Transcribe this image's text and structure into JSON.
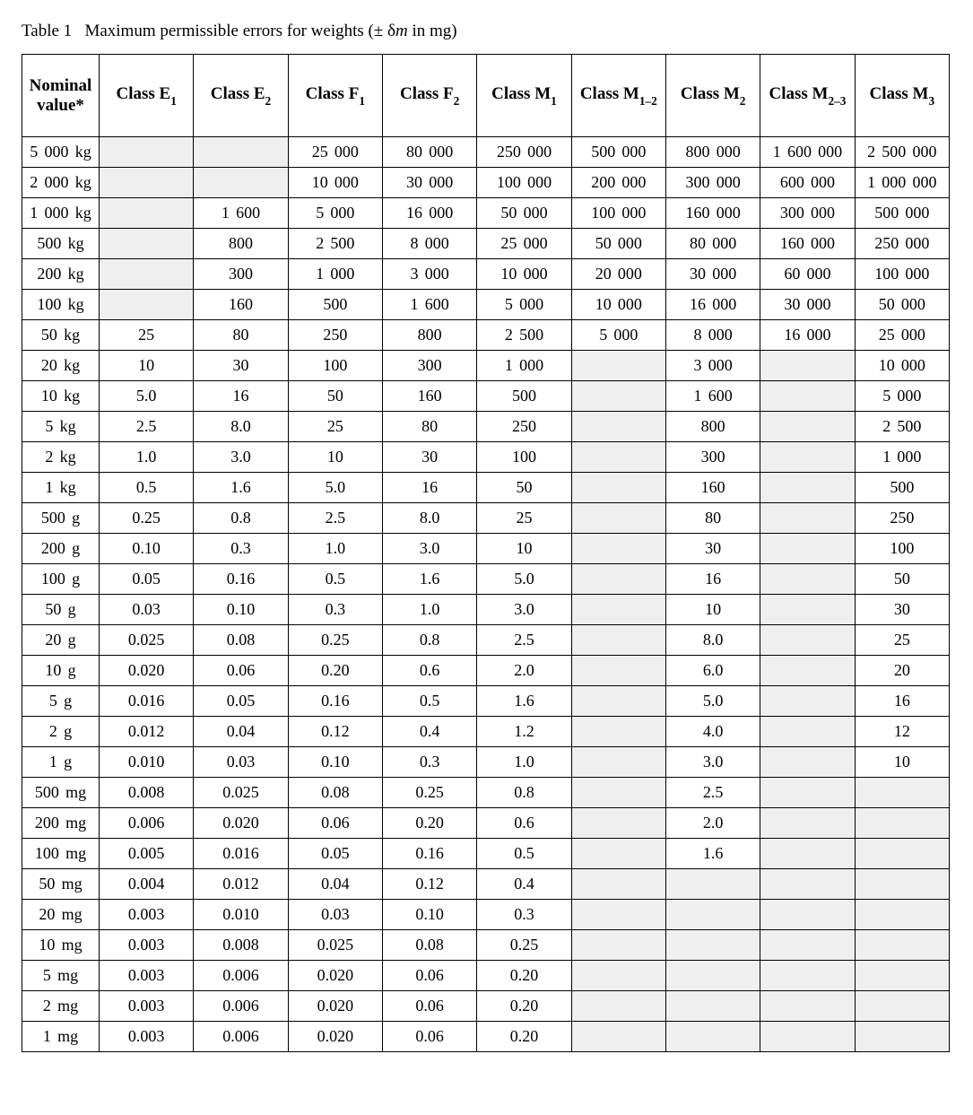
{
  "title_prefix": "Table 1",
  "title_text": "Maximum permissible errors for weights (± δ",
  "title_italic": "m",
  "title_suffix": " in mg)",
  "headers": [
    {
      "label": "Nominal value*",
      "sub": ""
    },
    {
      "label": "Class E",
      "sub": "1"
    },
    {
      "label": "Class E",
      "sub": "2"
    },
    {
      "label": "Class F",
      "sub": "1"
    },
    {
      "label": "Class F",
      "sub": "2"
    },
    {
      "label": "Class M",
      "sub": "1"
    },
    {
      "label": "Class M",
      "sub": "1–2"
    },
    {
      "label": "Class M",
      "sub": "2"
    },
    {
      "label": "Class M",
      "sub": "2–3"
    },
    {
      "label": "Class M",
      "sub": "3"
    }
  ],
  "chart_data": {
    "type": "table",
    "title": "Maximum permissible errors for weights (± δm in mg)",
    "columns": [
      "Nominal value",
      "Class E1",
      "Class E2",
      "Class F1",
      "Class F2",
      "Class M1",
      "Class M1-2",
      "Class M2",
      "Class M2-3",
      "Class M3"
    ],
    "rows": [
      {
        "nominal": "5 000 kg",
        "values": [
          "",
          "",
          "25 000",
          "80 000",
          "250 000",
          "500 000",
          "800 000",
          "1 600 000",
          "2 500 000"
        ],
        "shaded": [
          0,
          1
        ]
      },
      {
        "nominal": "2 000 kg",
        "values": [
          "",
          "",
          "10 000",
          "30 000",
          "100 000",
          "200 000",
          "300 000",
          "600 000",
          "1 000 000"
        ],
        "shaded": [
          0,
          1
        ]
      },
      {
        "nominal": "1 000 kg",
        "values": [
          "",
          "1 600",
          "5 000",
          "16 000",
          "50 000",
          "100 000",
          "160 000",
          "300 000",
          "500 000"
        ],
        "shaded": [
          0
        ]
      },
      {
        "nominal": "500 kg",
        "values": [
          "",
          "800",
          "2 500",
          "8 000",
          "25 000",
          "50 000",
          "80 000",
          "160 000",
          "250 000"
        ],
        "shaded": [
          0
        ]
      },
      {
        "nominal": "200 kg",
        "values": [
          "",
          "300",
          "1 000",
          "3 000",
          "10 000",
          "20 000",
          "30 000",
          "60 000",
          "100 000"
        ],
        "shaded": [
          0
        ]
      },
      {
        "nominal": "100 kg",
        "values": [
          "",
          "160",
          "500",
          "1 600",
          "5 000",
          "10 000",
          "16 000",
          "30 000",
          "50 000"
        ],
        "shaded": [
          0
        ]
      },
      {
        "nominal": "50 kg",
        "values": [
          "25",
          "80",
          "250",
          "800",
          "2 500",
          "5 000",
          "8 000",
          "16 000",
          "25 000"
        ],
        "shaded": []
      },
      {
        "nominal": "20 kg",
        "values": [
          "10",
          "30",
          "100",
          "300",
          "1 000",
          "",
          "3 000",
          "",
          "10 000"
        ],
        "shaded": [
          5,
          7
        ]
      },
      {
        "nominal": "10 kg",
        "values": [
          "5.0",
          "16",
          "50",
          "160",
          "500",
          "",
          "1 600",
          "",
          "5 000"
        ],
        "shaded": [
          5,
          7
        ]
      },
      {
        "nominal": "5 kg",
        "values": [
          "2.5",
          "8.0",
          "25",
          "80",
          "250",
          "",
          "800",
          "",
          "2 500"
        ],
        "shaded": [
          5,
          7
        ]
      },
      {
        "nominal": "2 kg",
        "values": [
          "1.0",
          "3.0",
          "10",
          "30",
          "100",
          "",
          "300",
          "",
          "1 000"
        ],
        "shaded": [
          5,
          7
        ]
      },
      {
        "nominal": "1 kg",
        "values": [
          "0.5",
          "1.6",
          "5.0",
          "16",
          "50",
          "",
          "160",
          "",
          "500"
        ],
        "shaded": [
          5,
          7
        ]
      },
      {
        "nominal": "500 g",
        "values": [
          "0.25",
          "0.8",
          "2.5",
          "8.0",
          "25",
          "",
          "80",
          "",
          "250"
        ],
        "shaded": [
          5,
          7
        ]
      },
      {
        "nominal": "200 g",
        "values": [
          "0.10",
          "0.3",
          "1.0",
          "3.0",
          "10",
          "",
          "30",
          "",
          "100"
        ],
        "shaded": [
          5,
          7
        ]
      },
      {
        "nominal": "100 g",
        "values": [
          "0.05",
          "0.16",
          "0.5",
          "1.6",
          "5.0",
          "",
          "16",
          "",
          "50"
        ],
        "shaded": [
          5,
          7
        ]
      },
      {
        "nominal": "50 g",
        "values": [
          "0.03",
          "0.10",
          "0.3",
          "1.0",
          "3.0",
          "",
          "10",
          "",
          "30"
        ],
        "shaded": [
          5,
          7
        ]
      },
      {
        "nominal": "20 g",
        "values": [
          "0.025",
          "0.08",
          "0.25",
          "0.8",
          "2.5",
          "",
          "8.0",
          "",
          "25"
        ],
        "shaded": [
          5,
          7
        ]
      },
      {
        "nominal": "10 g",
        "values": [
          "0.020",
          "0.06",
          "0.20",
          "0.6",
          "2.0",
          "",
          "6.0",
          "",
          "20"
        ],
        "shaded": [
          5,
          7
        ]
      },
      {
        "nominal": "5 g",
        "values": [
          "0.016",
          "0.05",
          "0.16",
          "0.5",
          "1.6",
          "",
          "5.0",
          "",
          "16"
        ],
        "shaded": [
          5,
          7
        ]
      },
      {
        "nominal": "2 g",
        "values": [
          "0.012",
          "0.04",
          "0.12",
          "0.4",
          "1.2",
          "",
          "4.0",
          "",
          "12"
        ],
        "shaded": [
          5,
          7
        ]
      },
      {
        "nominal": "1 g",
        "values": [
          "0.010",
          "0.03",
          "0.10",
          "0.3",
          "1.0",
          "",
          "3.0",
          "",
          "10"
        ],
        "shaded": [
          5,
          7
        ]
      },
      {
        "nominal": "500 mg",
        "values": [
          "0.008",
          "0.025",
          "0.08",
          "0.25",
          "0.8",
          "",
          "2.5",
          "",
          ""
        ],
        "shaded": [
          5,
          7,
          8
        ]
      },
      {
        "nominal": "200 mg",
        "values": [
          "0.006",
          "0.020",
          "0.06",
          "0.20",
          "0.6",
          "",
          "2.0",
          "",
          ""
        ],
        "shaded": [
          5,
          7,
          8
        ]
      },
      {
        "nominal": "100 mg",
        "values": [
          "0.005",
          "0.016",
          "0.05",
          "0.16",
          "0.5",
          "",
          "1.6",
          "",
          ""
        ],
        "shaded": [
          5,
          7,
          8
        ]
      },
      {
        "nominal": "50 mg",
        "values": [
          "0.004",
          "0.012",
          "0.04",
          "0.12",
          "0.4",
          "",
          "",
          "",
          ""
        ],
        "shaded": [
          5,
          6,
          7,
          8
        ]
      },
      {
        "nominal": "20 mg",
        "values": [
          "0.003",
          "0.010",
          "0.03",
          "0.10",
          "0.3",
          "",
          "",
          "",
          ""
        ],
        "shaded": [
          5,
          6,
          7,
          8
        ]
      },
      {
        "nominal": "10 mg",
        "values": [
          "0.003",
          "0.008",
          "0.025",
          "0.08",
          "0.25",
          "",
          "",
          "",
          ""
        ],
        "shaded": [
          5,
          6,
          7,
          8
        ]
      },
      {
        "nominal": "5 mg",
        "values": [
          "0.003",
          "0.006",
          "0.020",
          "0.06",
          "0.20",
          "",
          "",
          "",
          ""
        ],
        "shaded": [
          5,
          6,
          7,
          8
        ]
      },
      {
        "nominal": "2 mg",
        "values": [
          "0.003",
          "0.006",
          "0.020",
          "0.06",
          "0.20",
          "",
          "",
          "",
          ""
        ],
        "shaded": [
          5,
          6,
          7,
          8
        ]
      },
      {
        "nominal": "1 mg",
        "values": [
          "0.003",
          "0.006",
          "0.020",
          "0.06",
          "0.20",
          "",
          "",
          "",
          ""
        ],
        "shaded": [
          5,
          6,
          7,
          8
        ]
      }
    ]
  }
}
